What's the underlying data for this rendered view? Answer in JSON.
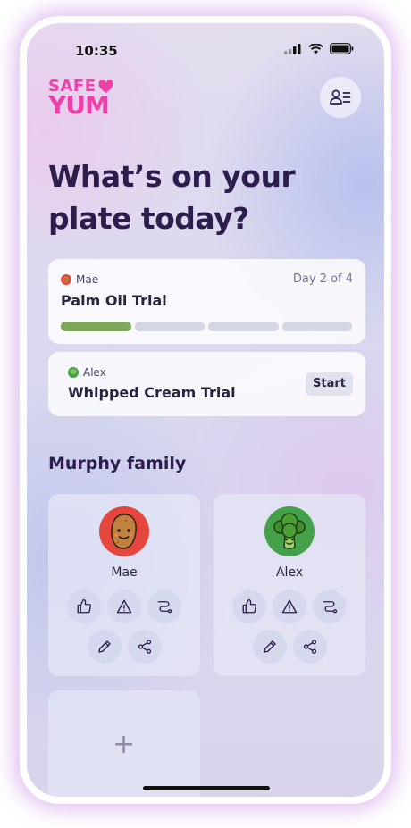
{
  "status_bar": {
    "time": "10:35"
  },
  "logo": {
    "line1": "SAFE",
    "line2": "YUM",
    "color": "#ef3fa8"
  },
  "headline": "What’s on your plate today?",
  "trials": [
    {
      "person": "Mae",
      "title": "Palm Oil Trial",
      "day_label": "Day 2 of 4",
      "progress": "1 of 4 segments complete",
      "segments_total": 4,
      "segments_done": 1
    },
    {
      "person": "Alex",
      "title": "Whipped Cream Trial",
      "action_label": "Start"
    }
  ],
  "section": {
    "title": "Murphy family"
  },
  "members": [
    {
      "name": "Mae",
      "avatar": "potato-avatar"
    },
    {
      "name": "Alex",
      "avatar": "broccoli-avatar"
    }
  ],
  "member_actions": [
    "thumbs-up-icon",
    "warning-icon",
    "route-icon",
    "pencil-icon",
    "share-icon"
  ],
  "add_member": {
    "symbol": "+"
  },
  "colors": {
    "accent": "#ef3fa8",
    "heading": "#2c1d4c",
    "progress_done": "#80a85c",
    "progress_todo": "#d4d6e3"
  }
}
